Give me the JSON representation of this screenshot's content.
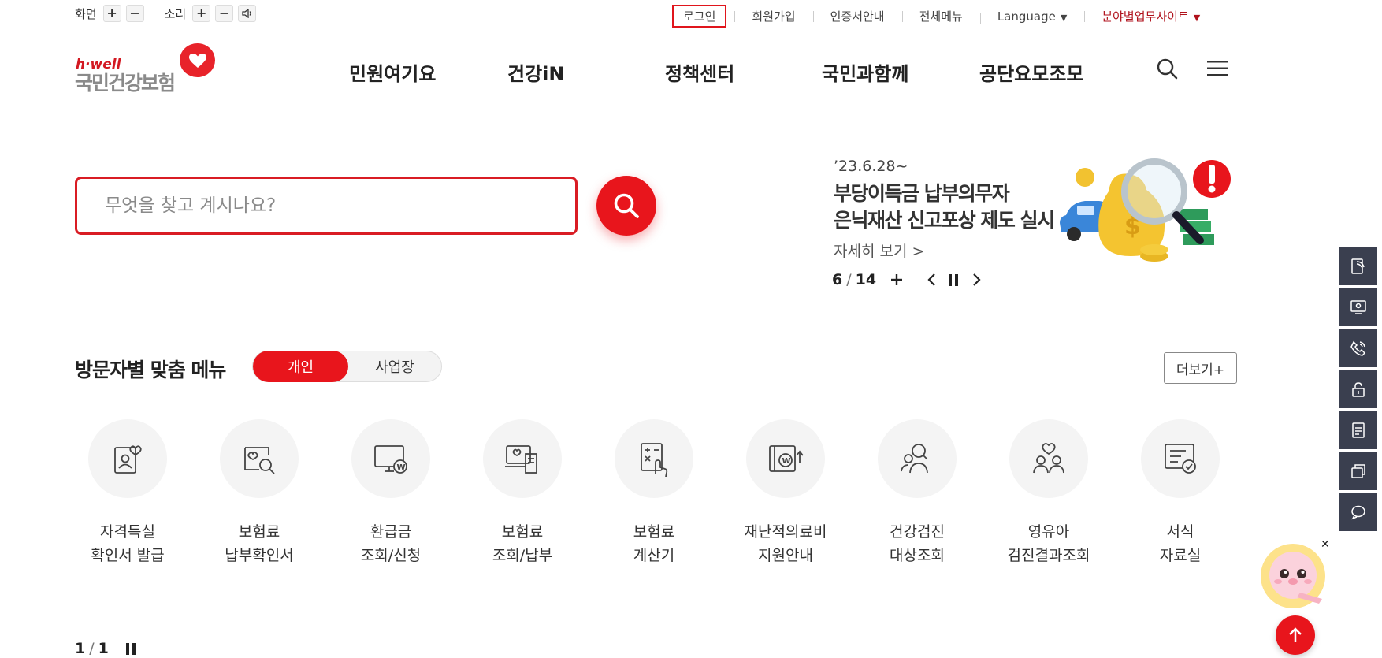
{
  "utility": {
    "screen_label": "화면",
    "sound_label": "소리",
    "login": "로그인",
    "signup": "회원가입",
    "cert_guide": "인증서안내",
    "sitemap": "전체메뉴",
    "language": "Language",
    "family_sites": "분야별업무사이트"
  },
  "logo": {
    "hwell": "h·well",
    "name": "국민건강보험"
  },
  "gnb": [
    "민원여기요",
    "건강iN",
    "정책센터",
    "국민과함께",
    "공단요모조모"
  ],
  "search": {
    "placeholder": "무엇을 찾고 계시나요?"
  },
  "banner": {
    "date": "’23.6.28~",
    "title_line1": "부당이득금 납부의무자",
    "title_line2": "은닉재산 신고포상 제도 실시",
    "more": "자세히 보기 >",
    "current": "6",
    "separator": "/",
    "total": "14"
  },
  "custom_menu": {
    "title": "방문자별 맞춤 메뉴",
    "tab_personal": "개인",
    "tab_business": "사업장",
    "more": "더보기+",
    "items": [
      {
        "line1": "자격득실",
        "line2": "확인서 발급"
      },
      {
        "line1": "보험료",
        "line2": "납부확인서"
      },
      {
        "line1": "환급금",
        "line2": "조회/신청"
      },
      {
        "line1": "보험료",
        "line2": "조회/납부"
      },
      {
        "line1": "보험료",
        "line2": "계산기"
      },
      {
        "line1": "재난적의료비",
        "line2": "지원안내"
      },
      {
        "line1": "건강검진",
        "line2": "대상조회"
      },
      {
        "line1": "영유아",
        "line2": "검진결과조회"
      },
      {
        "line1": "서식",
        "line2": "자료실"
      }
    ],
    "page_current": "1",
    "page_separator": "/",
    "page_total": "1"
  },
  "colors": {
    "brand_red": "#e8151c",
    "side_bar": "#3a3f4f"
  }
}
